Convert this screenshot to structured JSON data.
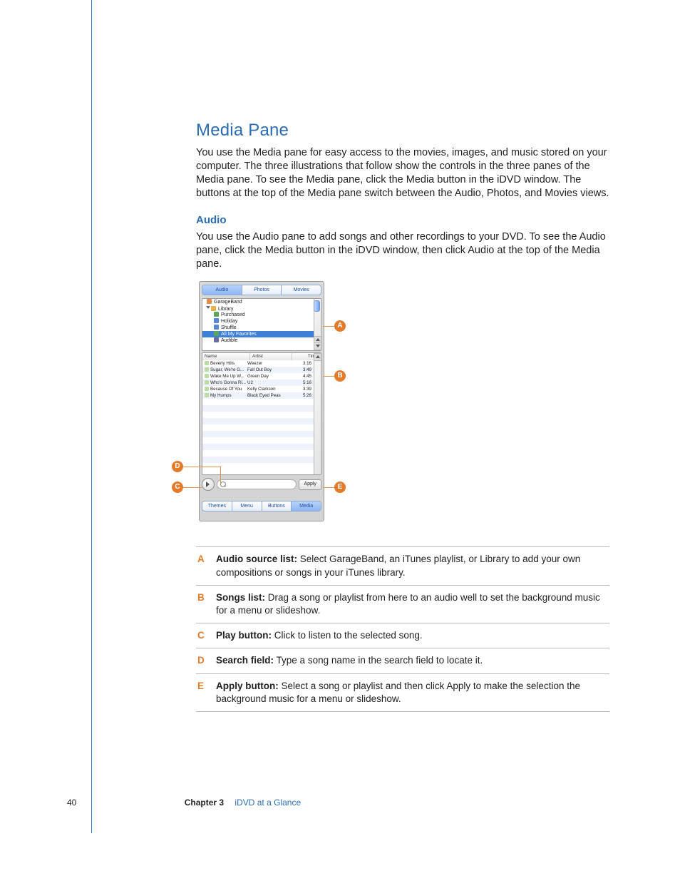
{
  "page": {
    "number": "40",
    "chapter_label": "Chapter 3",
    "chapter_title": "iDVD at a Glance"
  },
  "headings": {
    "media_pane": "Media Pane",
    "audio": "Audio"
  },
  "paragraphs": {
    "media_pane": "You use the Media pane for easy access to the movies, images, and music stored on your computer. The three illustrations that follow show the controls in the three panes of the Media pane. To see the Media pane, click the Media button in the iDVD window. The buttons at the top of the Media pane switch between the Audio, Photos, and Movies views.",
    "audio": "You use the Audio pane to add songs and other recordings to your DVD. To see the Audio pane, click the Media button in the iDVD window, then click Audio at the top of the Media pane."
  },
  "panel": {
    "tabs_top": {
      "audio": "Audio",
      "photos": "Photos",
      "movies": "Movies"
    },
    "sources": {
      "garageband": "GarageBand",
      "library": "Library",
      "purchased": "Purchased",
      "holiday": "Holiday",
      "shuffle": "Shuffle",
      "all_my_favorites": "All My Favorites",
      "audible": "Audible"
    },
    "columns": {
      "name": "Name",
      "artist": "Artist",
      "time": "Time"
    },
    "songs": [
      {
        "name": "Beverly Hills",
        "artist": "Weezer",
        "time": "3:16"
      },
      {
        "name": "Sugar, We're G...",
        "artist": "Fall Out Boy",
        "time": "3:49"
      },
      {
        "name": "Wake Me Up W...",
        "artist": "Green Day",
        "time": "4:45"
      },
      {
        "name": "Who's Gonna Ri...",
        "artist": "U2",
        "time": "5:16"
      },
      {
        "name": "Because Of You",
        "artist": "Kelly Clarkson",
        "time": "3:39"
      },
      {
        "name": "My Humps",
        "artist": "Black Eyed Peas",
        "time": "5:26"
      }
    ],
    "apply": "Apply",
    "tabs_bottom": {
      "themes": "Themes",
      "menu": "Menu",
      "buttons": "Buttons",
      "media": "Media"
    }
  },
  "callouts": {
    "a": "A",
    "b": "B",
    "c": "C",
    "d": "D",
    "e": "E"
  },
  "legend": {
    "a": {
      "term": "Audio source list:",
      "desc": "  Select GarageBand, an iTunes playlist, or Library to add your own compositions or songs in your iTunes library."
    },
    "b": {
      "term": "Songs list:",
      "desc": "  Drag a song or playlist from here to an audio well to set the background music for a menu or slideshow."
    },
    "c": {
      "term": "Play button:",
      "desc": "  Click to listen to the selected song."
    },
    "d": {
      "term": "Search field:",
      "desc": "  Type a song name in the search field to locate it."
    },
    "e": {
      "term": "Apply button:",
      "desc": "  Select a song or playlist and then click Apply to make the selection the background music for a menu or slideshow."
    }
  }
}
